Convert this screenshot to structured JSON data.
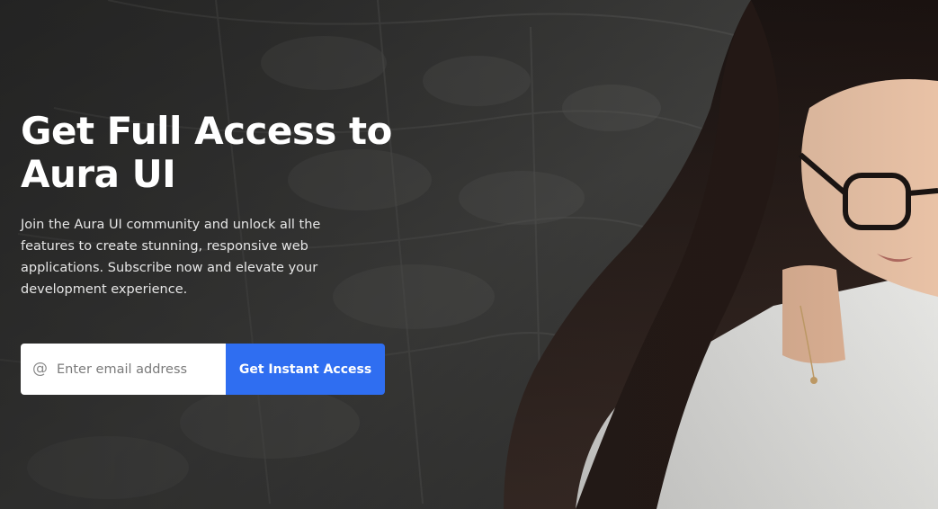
{
  "hero": {
    "title_line1": "Get Full Access to",
    "title_line2": "Aura UI",
    "description": "Join the Aura UI community and unlock all the features to create stunning, responsive web applications. Subscribe now and elevate your development experience.",
    "background_image": "woman-with-glasses-on-couch-photo"
  },
  "signup": {
    "icon": "at-icon",
    "email_placeholder": "Enter email address",
    "email_value": "",
    "button_label": "Get Instant Access"
  },
  "colors": {
    "accent": "#2f6ef1",
    "overlay": "#3a3a38",
    "text": "#ffffff"
  }
}
